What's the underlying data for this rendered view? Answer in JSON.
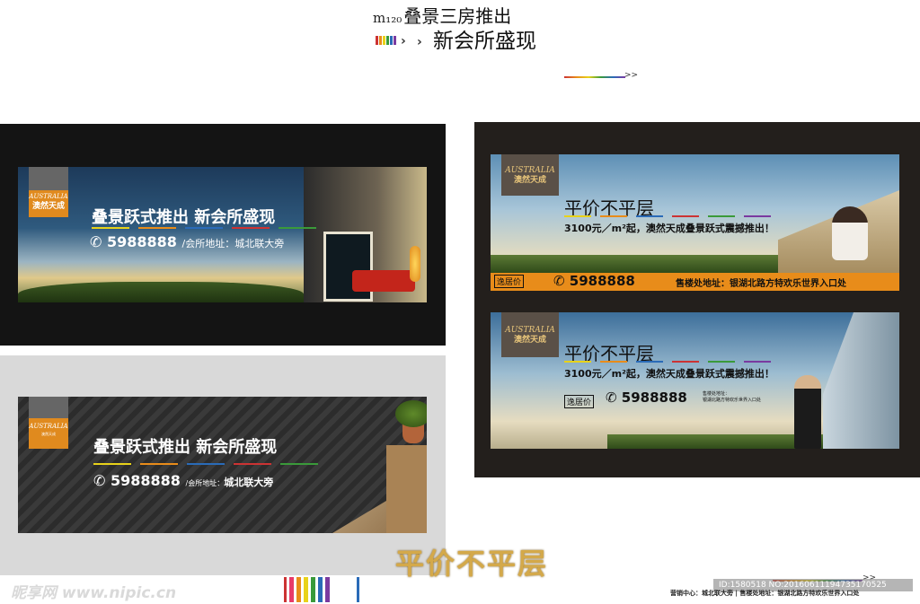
{
  "header": {
    "prefix": "m₁₂₀",
    "line1": "叠景三房推出",
    "line2": "新会所盛现",
    "chevrons": ">",
    "small_chevrons": ">>"
  },
  "brand": {
    "logo_en": "AUSTRALIA",
    "logo_cn": "澳然天成",
    "logo_sub": "澳然天成"
  },
  "banner_a": {
    "headline": "叠景跃式推出  新会所盛现",
    "phone": "5988888",
    "address": "/会所地址：城北联大旁"
  },
  "banner_b": {
    "headline": "叠景跃式推出  新会所盛现",
    "phone": "5988888",
    "address_label": "/会所地址：",
    "address": "城北联大旁"
  },
  "banner_c": {
    "headline": "平价不平层",
    "subline": "3100元／m²起，澳然天成叠景跃式震撼推出！",
    "badge": "逸居价",
    "phone": "5988888",
    "address": "售楼处地址：银湖北路方特欢乐世界入口处"
  },
  "banner_d": {
    "headline": "平价不平层",
    "subline": "3100元／m²起，澳然天成叠景跃式震撼推出！",
    "badge": "逸居价",
    "phone": "5988888",
    "address_l1": "售楼处地址：",
    "address_l2": "银湖北路方特欢乐世界入口处"
  },
  "bottom": {
    "big_text": "平价不平层",
    "watermark": "昵享网 www.nipic.cn",
    "id_line": "ID:1580518 NO:20160611194735170525",
    "contact": "营销中心：城北联大旁  |  售楼处地址：银湖北路方特欢乐世界入口处"
  },
  "colors": {
    "accent_orange": "#e08a1e",
    "panel_black": "#141414",
    "panel_gray": "#d9d9d9",
    "stripe_dark": "#3a3a3a"
  }
}
